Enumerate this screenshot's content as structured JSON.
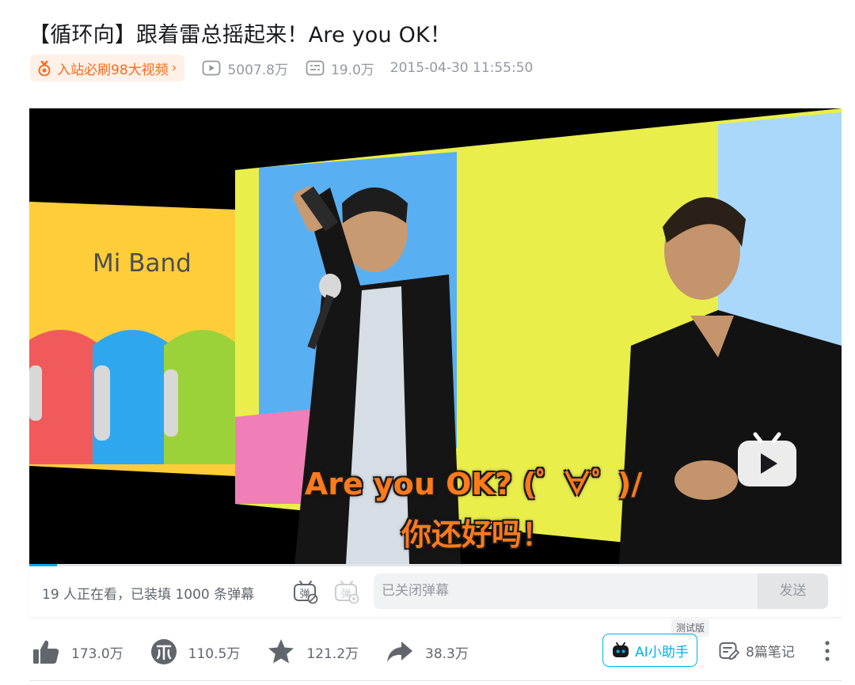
{
  "video": {
    "title": "【循环向】跟着雷总摇起来！Are you OK！",
    "rank_badge": "入站必刷98大视频",
    "rank_chevron": "›",
    "views": "5007.8万",
    "danmaku_count": "19.0万",
    "publish_time": "2015-04-30 11:55:50"
  },
  "player": {
    "slide_text": "Mi Band",
    "subtitle_line1": "Are you OK? (ﾟ ∀ﾟ )/",
    "subtitle_line2": "你还好吗！",
    "progress": 0.034
  },
  "danmaku_bar": {
    "viewers_text": "19 人正在看，已装填 1000 条弹幕",
    "input_placeholder": "已关闭弹幕",
    "send_label": "发送"
  },
  "actions": {
    "like": "173.0万",
    "coin": "110.5万",
    "favorite": "121.2万",
    "share": "38.3万",
    "ai_label": "AI小助手",
    "ai_tag": "测试版",
    "notes": "8篇笔记"
  },
  "colors": {
    "accent": "#00aeec",
    "badge": "#ff6a1a",
    "subtitle": "#ff7a1a"
  }
}
